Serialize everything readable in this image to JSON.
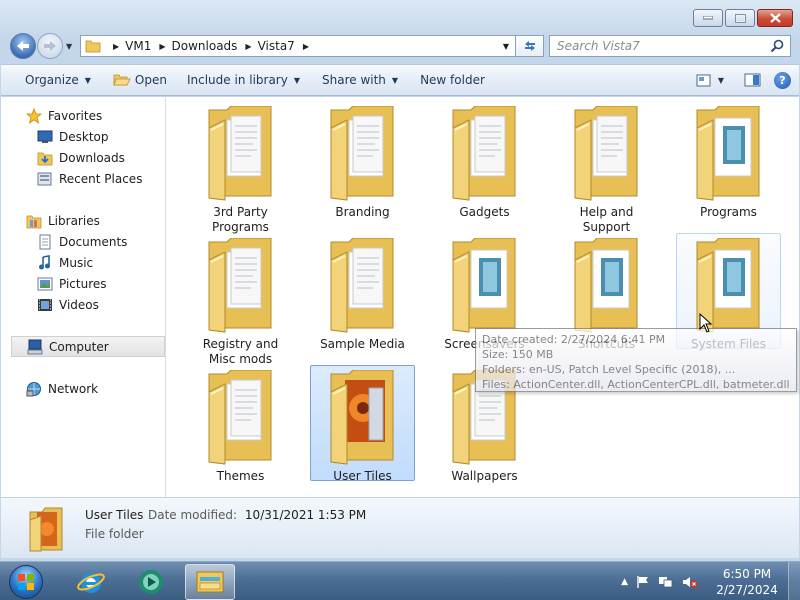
{
  "window": {
    "caption_buttons": [
      "minimize",
      "maximize",
      "close"
    ]
  },
  "address": {
    "breadcrumb": [
      "VM1",
      "Downloads",
      "Vista7"
    ]
  },
  "search": {
    "placeholder": "Search Vista7"
  },
  "toolbar": {
    "organize": "Organize",
    "open": "Open",
    "include_in_library": "Include in library",
    "share_with": "Share with",
    "new_folder": "New folder"
  },
  "sidebar": {
    "favorites": "Favorites",
    "desktop": "Desktop",
    "downloads": "Downloads",
    "recent_places": "Recent Places",
    "libraries": "Libraries",
    "documents": "Documents",
    "music": "Music",
    "pictures": "Pictures",
    "videos": "Videos",
    "computer": "Computer",
    "network": "Network"
  },
  "folders": [
    {
      "label": "3rd Party Programs",
      "icon": "folder-docs-icon"
    },
    {
      "label": "Branding",
      "icon": "folder-docs-icon"
    },
    {
      "label": "Gadgets",
      "icon": "folder-docs-icon"
    },
    {
      "label": "Help and Support",
      "icon": "folder-docs-icon"
    },
    {
      "label": "Programs",
      "icon": "folder-images-icon"
    },
    {
      "label": "Registry and Misc mods",
      "icon": "folder-docs-icon"
    },
    {
      "label": "Sample Media",
      "icon": "folder-docs-icon"
    },
    {
      "label": "Screensavers",
      "icon": "folder-images-icon"
    },
    {
      "label": "Shortcuts",
      "icon": "folder-images-icon"
    },
    {
      "label": "System Files",
      "icon": "folder-images-icon"
    },
    {
      "label": "Themes",
      "icon": "folder-docs-icon"
    },
    {
      "label": "User Tiles",
      "icon": "folder-flower-icon"
    },
    {
      "label": "Wallpapers",
      "icon": "folder-docs-icon"
    }
  ],
  "tooltip": {
    "date_created": "Date created: 2/27/2024 6:41 PM",
    "size": "Size: 150 MB",
    "folders": "Folders: en-US, Patch Level Specific (2018), ...",
    "files": "Files: ActionCenter.dll, ActionCenterCPL.dll, batmeter.dll, ..."
  },
  "details": {
    "name": "User Tiles",
    "date_modified_label": "Date modified:",
    "date_modified_value": "10/31/2021 1:53 PM",
    "type": "File folder"
  },
  "taskbar": {
    "time": "6:50 PM",
    "date": "2/27/2024"
  },
  "colors": {
    "folder_yellow": "#f3d37a",
    "selection_blue": "#c1dcfc",
    "taskbar_blue": "#4d6f95"
  }
}
